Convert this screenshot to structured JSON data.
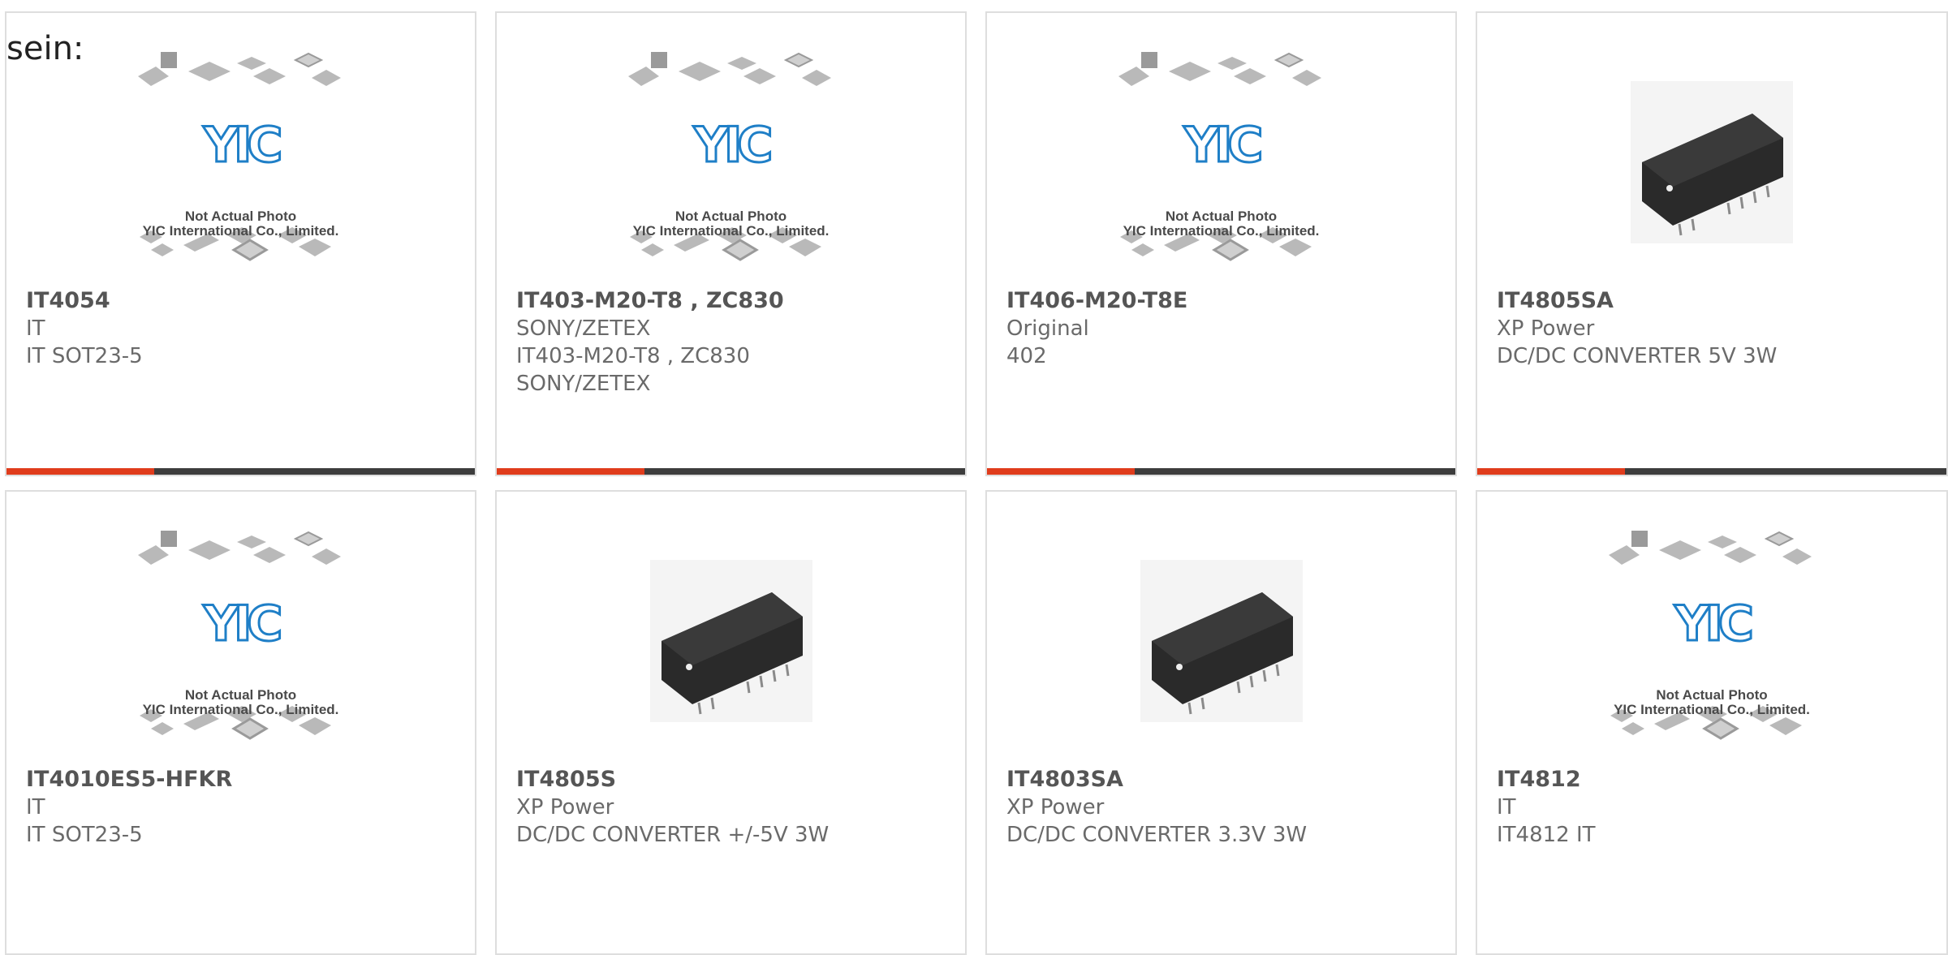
{
  "intro_text": "sein:",
  "placeholder": {
    "logo": "YIC",
    "line1": "Not Actual Photo",
    "line2": "YIC International Co., Limited."
  },
  "colors": {
    "card_border": "#dedede",
    "bar_accent": "#e03c1c",
    "bar_rest": "#3d3d3d",
    "logo_blue": "#1f7fc7",
    "part_number": "#555555",
    "detail_text": "#6a6a6a"
  },
  "products": [
    {
      "part_number": "IT4054",
      "lines": [
        "IT",
        "IT SOT23-5"
      ],
      "image": "placeholder",
      "bar": true
    },
    {
      "part_number": "IT403-M20-T8 , ZC830",
      "lines": [
        "SONY/ZETEX",
        "IT403-M20-T8 , ZC830",
        "SONY/ZETEX"
      ],
      "image": "placeholder",
      "bar": true
    },
    {
      "part_number": "IT406-M20-T8E",
      "lines": [
        "Original",
        "402"
      ],
      "image": "placeholder",
      "bar": true
    },
    {
      "part_number": "IT4805SA",
      "lines": [
        "XP Power",
        "DC/DC CONVERTER 5V 3W"
      ],
      "image": "xp-module",
      "bar": true
    },
    {
      "part_number": "IT4010ES5-HFKR",
      "lines": [
        "IT",
        "IT SOT23-5"
      ],
      "image": "placeholder",
      "bar": false
    },
    {
      "part_number": "IT4805S",
      "lines": [
        "XP Power",
        "DC/DC CONVERTER +/-5V 3W"
      ],
      "image": "xp-module",
      "bar": false
    },
    {
      "part_number": "IT4803SA",
      "lines": [
        "XP Power",
        "DC/DC CONVERTER 3.3V 3W"
      ],
      "image": "xp-module",
      "bar": false
    },
    {
      "part_number": "IT4812",
      "lines": [
        "IT",
        "IT4812 IT"
      ],
      "image": "placeholder",
      "bar": false
    }
  ]
}
